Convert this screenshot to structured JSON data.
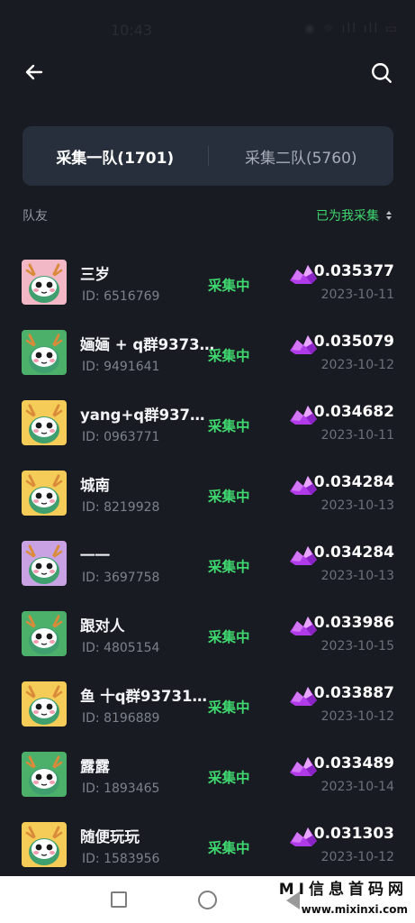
{
  "status_bar": {
    "time": "10:43",
    "icons": "◉ ☼ ıll ıll ▭"
  },
  "tabs": [
    {
      "label": "采集一队(1701)"
    },
    {
      "label": "采集二队(5760)"
    }
  ],
  "list_header": {
    "label": "队友",
    "sort_label": "已为我采集"
  },
  "colors": {
    "accent_green": "#3fd76f",
    "background": "#191b22",
    "tab_bg": "#262f3b",
    "gem": "#b13be8"
  },
  "members": [
    {
      "name": "三岁",
      "id": "ID:  6516769",
      "status": "采集中",
      "amount": "0.035377",
      "date": "2023-10-11",
      "avatar": "pink"
    },
    {
      "name": "婳婳 + q群9373...",
      "id": "ID:  9491641",
      "status": "采集中",
      "amount": "0.035079",
      "date": "2023-10-12",
      "avatar": "green"
    },
    {
      "name": "yang+q群93731...",
      "id": "ID:  0963771",
      "status": "采集中",
      "amount": "0.034682",
      "date": "2023-10-11",
      "avatar": "yellow"
    },
    {
      "name": "城南",
      "id": "ID:  8219928",
      "status": "采集中",
      "amount": "0.034284",
      "date": "2023-10-13",
      "avatar": "yellow"
    },
    {
      "name": "一一",
      "id": "ID:  3697758",
      "status": "采集中",
      "amount": "0.034284",
      "date": "2023-10-13",
      "avatar": "purple"
    },
    {
      "name": "跟对人",
      "id": "ID:  4805154",
      "status": "采集中",
      "amount": "0.033986",
      "date": "2023-10-15",
      "avatar": "green"
    },
    {
      "name": "鱼 十q群937314...",
      "id": "ID:  8196889",
      "status": "采集中",
      "amount": "0.033887",
      "date": "2023-10-12",
      "avatar": "yellow"
    },
    {
      "name": "露露",
      "id": "ID:  1893465",
      "status": "采集中",
      "amount": "0.033489",
      "date": "2023-10-14",
      "avatar": "green"
    },
    {
      "name": "随便玩玩",
      "id": "ID:  1583956",
      "status": "采集中",
      "amount": "0.031303",
      "date": "2023-10-12",
      "avatar": "yellow"
    }
  ],
  "watermark": {
    "title": "MI信息首码网",
    "url": "www.mixinxi.com"
  }
}
